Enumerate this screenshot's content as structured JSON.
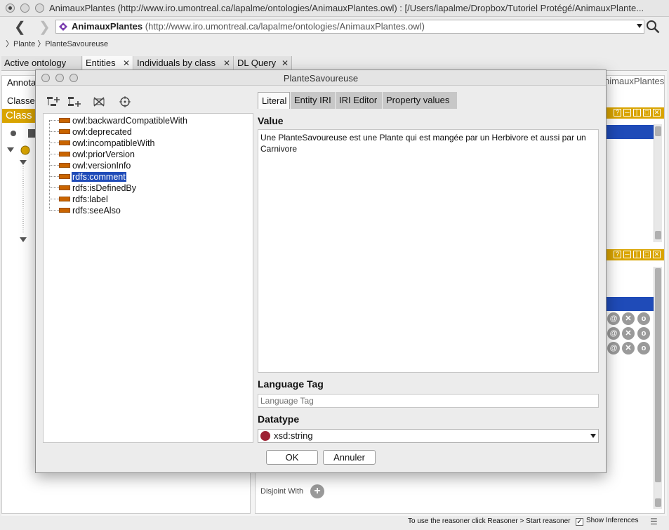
{
  "window": {
    "title": "AnimauxPlantes (http://www.iro.umontreal.ca/lapalme/ontologies/AnimauxPlantes.owl)  : [/Users/lapalme/Dropbox/Tutoriel Protégé/AnimauxPlante..."
  },
  "address": {
    "name": "AnimauxPlantes",
    "iri": "(http://www.iro.umontreal.ca/lapalme/ontologies/AnimauxPlantes.owl)"
  },
  "breadcrumb": [
    "Plante",
    "PlanteSavoureuse"
  ],
  "main_tabs": [
    {
      "label": "Active ontology"
    },
    {
      "label": "Entities"
    },
    {
      "label": "Individuals by class"
    },
    {
      "label": "DL Query"
    }
  ],
  "background": {
    "annotations_label": "Annota",
    "classes_label": "Classe",
    "class_bar": "Class",
    "onto_suffix": "nimauxPlantes",
    "disjoint_with": "Disjoint With"
  },
  "status": {
    "message": "To use the reasoner click Reasoner > Start reasoner",
    "show_inferences": "Show Inferences",
    "show_inferences_checked": true
  },
  "dialog": {
    "title": "PlanteSavoureuse",
    "properties": [
      {
        "label": "owl:backwardCompatibleWith"
      },
      {
        "label": "owl:deprecated"
      },
      {
        "label": "owl:incompatibleWith"
      },
      {
        "label": "owl:priorVersion"
      },
      {
        "label": "owl:versionInfo"
      },
      {
        "label": "rdfs:comment",
        "selected": true
      },
      {
        "label": "rdfs:isDefinedBy"
      },
      {
        "label": "rdfs:label"
      },
      {
        "label": "rdfs:seeAlso"
      }
    ],
    "tabs": [
      {
        "label": "Literal",
        "active": true
      },
      {
        "label": "Entity IRI"
      },
      {
        "label": "IRI Editor"
      },
      {
        "label": "Property values"
      }
    ],
    "value_label": "Value",
    "value_text": "Une PlanteSavoureuse est une Plante qui est mangée par un Herbivore et aussi par un Carnivore",
    "language_label": "Language Tag",
    "language_placeholder": "Language Tag",
    "datatype_label": "Datatype",
    "datatype_value": "xsd:string",
    "ok_label": "OK",
    "cancel_label": "Annuler"
  },
  "colors": {
    "protege_gold": "#d9a400",
    "selection_blue": "#1f4bb8",
    "property_orange": "#c96400",
    "datatype_red": "#9d2133"
  }
}
